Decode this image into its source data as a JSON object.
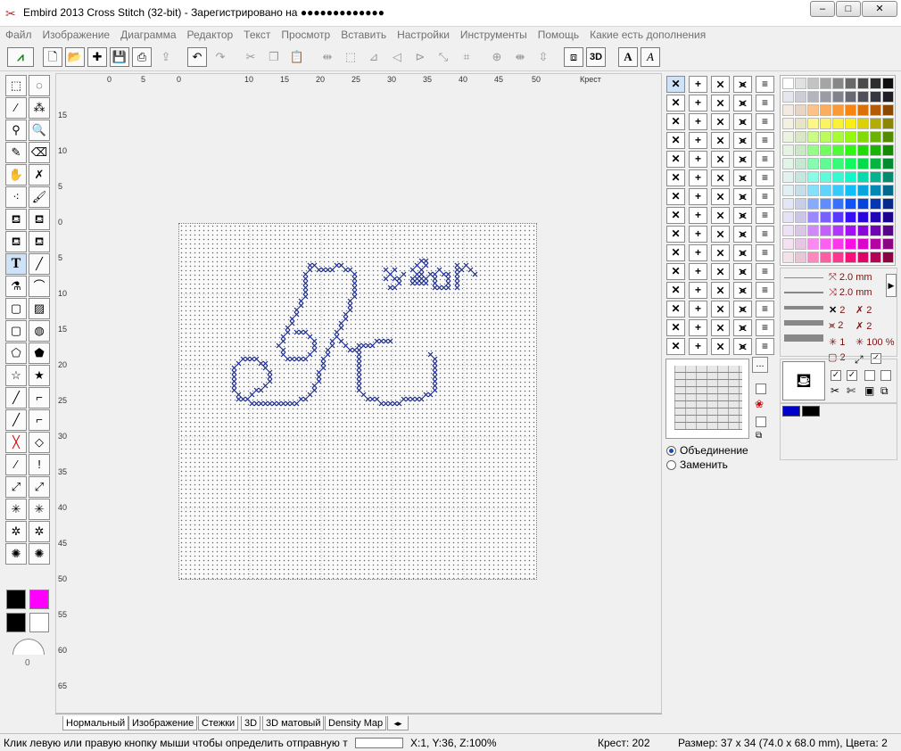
{
  "window": {
    "title": "Embird 2013 Cross Stitch (32-bit) - Зарегистрировано на ●●●●●●●●●●●●●",
    "minimize": "–",
    "maximize": "□",
    "close": "✕"
  },
  "menu": [
    "Файл",
    "Изображение",
    "Диаграмма",
    "Редактор",
    "Текст",
    "Просмотр",
    "Вставить",
    "Настройки",
    "Инструменты",
    "Помощь",
    "Какие есть дополнения"
  ],
  "ruler": {
    "unit_label": "Крест",
    "h_ticks": [
      "0",
      "5",
      "0",
      "10",
      "15",
      "20",
      "25",
      "30",
      "35",
      "40",
      "45",
      "50"
    ],
    "v_ticks": [
      "15",
      "10",
      "5",
      "0",
      "5",
      "10",
      "15",
      "20",
      "25",
      "30",
      "35",
      "40",
      "45",
      "50",
      "55",
      "60",
      "65"
    ]
  },
  "tabs": [
    "Нормальный",
    "Изображение",
    "Стежки",
    "3D",
    "3D матовый",
    "Density Map"
  ],
  "status": {
    "hint": "Клик левую или правую кнопку мыши чтобы определить отправную т",
    "coords": "X:1, Y:36, Z:100%",
    "cross": "Крест: 202",
    "size": "Размер: 37 x 34 (74.0 x 68.0 mm), Цвета: 2"
  },
  "stitch_options": {
    "len1": "2.0 mm",
    "len2": "2.0 mm",
    "cnt1": "2",
    "cnt2": "2",
    "cnt3": "2",
    "cnt4": "2",
    "cnt5": "1",
    "percent": "100 %",
    "cnt6": "2"
  },
  "fill_mode": {
    "option1": "Объединение",
    "option2": "Заменить"
  },
  "colors": {
    "fg": "#000000",
    "bg": "#ff00ff",
    "thread": "#0000cc",
    "stitch": "#1a2a8a"
  },
  "left_gauge_value": "0",
  "more_button": "..."
}
